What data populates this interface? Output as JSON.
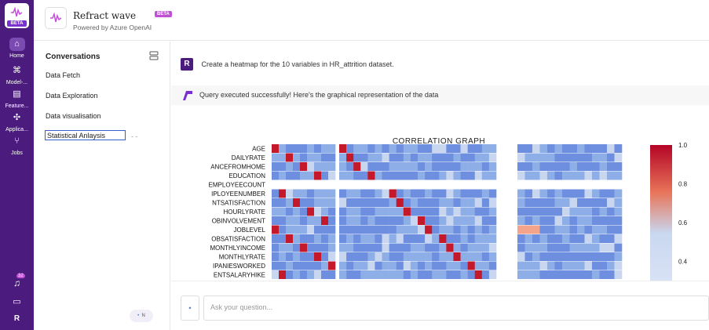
{
  "app": {
    "title": "Refract wave",
    "badge": "BETA",
    "subtitle": "Powered by Azure OpenAI",
    "logo_badge": "BETA"
  },
  "rail": {
    "items": [
      {
        "label": "Home",
        "icon": "home-icon"
      },
      {
        "label": "Model-...",
        "icon": "model-icon"
      },
      {
        "label": "Feature...",
        "icon": "feature-icon"
      },
      {
        "label": "Applica...",
        "icon": "applications-icon"
      },
      {
        "label": "Jobs",
        "icon": "jobs-icon"
      }
    ],
    "notification_count": "32",
    "profile_initial": "R"
  },
  "conversations": {
    "title": "Conversations",
    "items": [
      "Data Fetch",
      "Data Exploration",
      "Data visualisation",
      "Statistical Anlaysis"
    ],
    "more": "- -",
    "user_chip": "N"
  },
  "chat": {
    "user_avatar": "R",
    "question": "Create a heatmap for the 10 variables in HR_attrition dataset.",
    "answer": "Query executed successfully! Here's the graphical representation of the data",
    "input_placeholder": "Ask your question...",
    "add_label": "+"
  },
  "colors": {
    "brand": "#4b1c7d",
    "badge": "#c04fd6",
    "accent": "#3a5fcd"
  },
  "chart_data": {
    "type": "heatmap",
    "title": "CORRELATION GRAPH",
    "rows": [
      "AGE",
      "DAILYRATE",
      "ANCEFROMHOME",
      "EDUCATION",
      "EMPLOYEECOUNT",
      "IPLOYEENUMBER",
      "NTSATISFACTION",
      "HOURLYRATE",
      "OBINVOLVEMENT",
      "JOBLEVEL",
      "OBSATISFACTION",
      "MONTHLYINCOME",
      "MONTHLYRATE",
      "IPANIESWORKED",
      "ENTSALARYHIKE"
    ],
    "colorbar_ticks": [
      "1.0",
      "0.8",
      "0.6",
      "0.4"
    ],
    "colorbar_range": [
      0.3,
      1.0
    ]
  }
}
